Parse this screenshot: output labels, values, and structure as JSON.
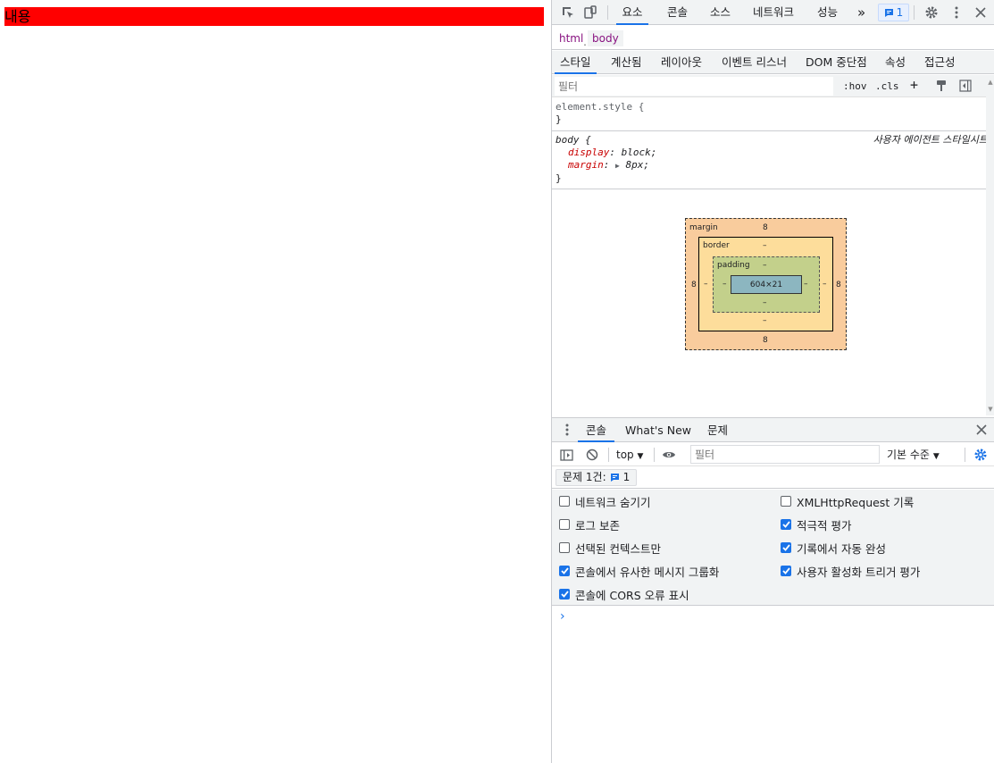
{
  "page": {
    "content_text": "내용",
    "bar_color": "#ff0000"
  },
  "devtools": {
    "main_tabs": [
      {
        "label": "요소"
      },
      {
        "label": "콘솔"
      },
      {
        "label": "소스"
      },
      {
        "label": "네트워크"
      },
      {
        "label": "성능"
      }
    ],
    "more_tabs_glyph": "»",
    "issues_count": "1",
    "breadcrumb_peek": "........",
    "breadcrumbs": [
      {
        "label": "html"
      },
      {
        "label": "body"
      }
    ],
    "sub_tabs": [
      {
        "label": "스타일"
      },
      {
        "label": "계산됨"
      },
      {
        "label": "레이아웃"
      },
      {
        "label": "이벤트 리스너"
      },
      {
        "label": "DOM 중단점"
      },
      {
        "label": "속성"
      },
      {
        "label": "접근성"
      }
    ],
    "styles_filter_placeholder": "필터",
    "hov_label": ":hov",
    "cls_label": ".cls",
    "plus_label": "+",
    "rules": {
      "element_style": {
        "selector": "element.style {",
        "close": "}"
      },
      "body": {
        "selector": "body {",
        "origin": "사용자 에이전트 스타일시트",
        "decl1_prop": "display",
        "decl1_val": "block;",
        "decl2_prop": "margin",
        "decl2_val": "8px;",
        "close": "}"
      }
    },
    "box_model": {
      "margin_label": "margin",
      "border_label": "border",
      "padding_label": "padding",
      "margin_top": "8",
      "margin_bottom": "8",
      "margin_left": "8",
      "margin_right": "8",
      "border_top": "–",
      "border_bottom": "–",
      "border_left": "–",
      "border_right": "–",
      "padding_top": "–",
      "padding_bottom": "–",
      "padding_left": "–",
      "padding_right": "–",
      "content": "604×21"
    },
    "drawer_tabs": [
      {
        "label": "콘솔"
      },
      {
        "label": "What's New"
      },
      {
        "label": "문제"
      }
    ],
    "console": {
      "context": "top",
      "filter_placeholder": "필터",
      "level": "기본 수준",
      "issues_label": "문제 1건:",
      "issues_count": "1",
      "options_left": [
        {
          "label": "네트워크 숨기기",
          "checked": false
        },
        {
          "label": "로그 보존",
          "checked": false
        },
        {
          "label": "선택된 컨텍스트만",
          "checked": false
        },
        {
          "label": "콘솔에서 유사한 메시지 그룹화",
          "checked": true
        },
        {
          "label": "콘솔에 CORS 오류 표시",
          "checked": true
        }
      ],
      "options_right": [
        {
          "label": "XMLHttpRequest 기록",
          "checked": false
        },
        {
          "label": "적극적 평가",
          "checked": true
        },
        {
          "label": "기록에서 자동 완성",
          "checked": true
        },
        {
          "label": "사용자 활성화 트리거 평가",
          "checked": true
        }
      ],
      "prompt_glyph": "›"
    },
    "accent_color": "#1a73e8"
  }
}
